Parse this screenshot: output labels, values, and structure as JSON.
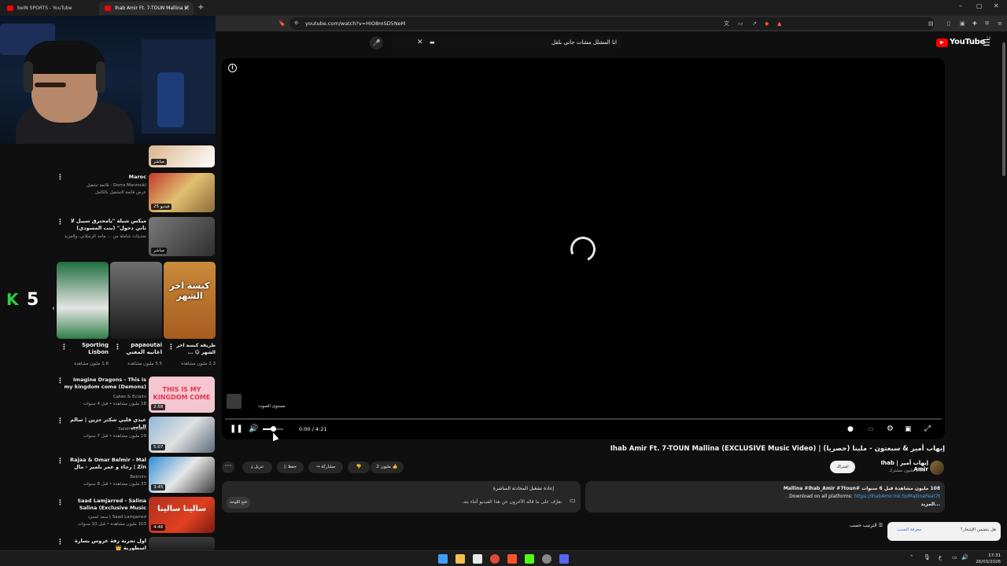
{
  "browser": {
    "tabs": [
      {
        "title": "beIN SPORTS - YouTube",
        "active": false
      },
      {
        "title": "Ihab Amir Ft. 7-TOUN Mallina (E",
        "active": true
      }
    ],
    "new_tab": "+",
    "window_controls": {
      "minimize": "–",
      "maximize": "▢",
      "close": "✕"
    },
    "url": "youtube.com/watch?v=HIO8mSD5NeM"
  },
  "webcam": {
    "score_letter": "K",
    "score_value": "5"
  },
  "masthead": {
    "search_value": "انا المشلل مشات جاني بلقل",
    "logo_text": "YouTube",
    "country_code": "SA"
  },
  "sidebar": {
    "items": [
      {
        "title": "",
        "channel": "",
        "meta": "",
        "duration": "مباشر",
        "thumb": [
          "#d9b48a",
          "#ffffff"
        ]
      },
      {
        "title": "Maroc",
        "channel": "Dorra Marzouki - قائمة تشغيل",
        "meta": "عرض قائمة التشغيل بالكامل",
        "duration": "25 فيديو",
        "thumb": [
          "#c0392b",
          "#8e6b3b"
        ]
      },
      {
        "title": "ميكس شيلة \"يامحترق سيبل لا تاني دخول\" (بنت المسودي) حسام بن قلبي",
        "channel": "",
        "meta": "تحديثات شاملة من ... ماجد الرسلاني، والمزيد",
        "duration": "مباشر",
        "thumb": [
          "#6b6b6b",
          "#2f2f2f"
        ]
      }
    ],
    "shorts": [
      {
        "title": "Sporting Lisbon",
        "views": "1.6 مليون مشاهدة"
      },
      {
        "title": "papaoutai اغانيه المغني ...",
        "views": "5.5 مليون مشاهدة"
      },
      {
        "title": "طريقة كبسة اخر الشهر 😋 ...",
        "views": "2.3 مليون مشاهدة",
        "overlay": "كبسة اخر الشهر"
      }
    ],
    "list": [
      {
        "title": "Imagine Dragons - This is my kingdom come (Demons)",
        "channel": "Cakes & Eclairs",
        "meta": "18 مليون مشاهدة • قبل 4 سنوات",
        "duration": "2:58",
        "overlay": "THIS IS MY KINGDOM COME"
      },
      {
        "title": "عبدي قلبي شكثر حزين | سالم اليامي",
        "channel": "Saleh Alyami",
        "meta": "19 مليون مشاهدة • قبل 7 سنوات",
        "duration": "5:07"
      },
      {
        "title": "Rajaa & Omar Belmir - Mal Zin | رجاء و عمر بلمير - مال الزين",
        "channel": "Belmirs",
        "meta": "33 مليون مشاهدة • قبل 8 سنوات",
        "duration": "3:45"
      },
      {
        "title": "Saad Lamjarred - Salina Salina (Exclusive Music Video) | ( ...",
        "channel": "Saad Lamjarred | سعد لمجرد",
        "meta": "103 مليون مشاهدة • قبل 10 سنوات",
        "duration": "4:46",
        "overlay": "سالينا سالينا"
      },
      {
        "title": "اول تجربة زفة عروس بسارة اسطورية 👑",
        "channel": "",
        "meta": "",
        "duration": ""
      }
    ]
  },
  "player": {
    "volume_tooltip": "مستوى الصوت",
    "time": "0:00 / 4:21",
    "volume_level": 0.5
  },
  "video": {
    "title": "إيهاب أمير & سبعتون - ملينا (حصريا) | Ihab Amir Ft. 7-TOUN Mallina (EXCLUSIVE Music Video)",
    "channel_name": "إيهاب أمير | Ihab Amir",
    "subscribers": "2.01 مليون مشترك",
    "join_label": "اشتراك",
    "actions": {
      "like_count": "2 مليون",
      "share": "مشاركة",
      "download": "تنزيل",
      "save": "حفظ"
    },
    "description": {
      "line1": "108 مليون مشاهدة قبل 6 سنوات #Mallina #Ihab_Amir #7toun",
      "line2_prefix": "Download on all platforms:",
      "line2_link": "https://IhabAmir.lnk.to/MallinaFeat7t...",
      "more": "...المزيد"
    },
    "chat_panel": {
      "title": "إعادة تشغيل المحادثة المباشرة",
      "subtitle": "تعرَّف على ما قاله الآخرون عن هذا الفيديو أثناء بثه.",
      "button": "فتح اللوحة"
    }
  },
  "comments": {
    "sort_by": "الترتيب حسب"
  },
  "toast": {
    "question": "هل يتضمن الإشعار؟",
    "link": "معرفة السبب"
  },
  "taskbar": {
    "time": "17:31",
    "date": "26/03/2026",
    "lang": "ع"
  },
  "colors": {
    "accent_red": "#ff0000",
    "link_blue": "#3ea6ff",
    "bg": "#0f0f0f"
  }
}
